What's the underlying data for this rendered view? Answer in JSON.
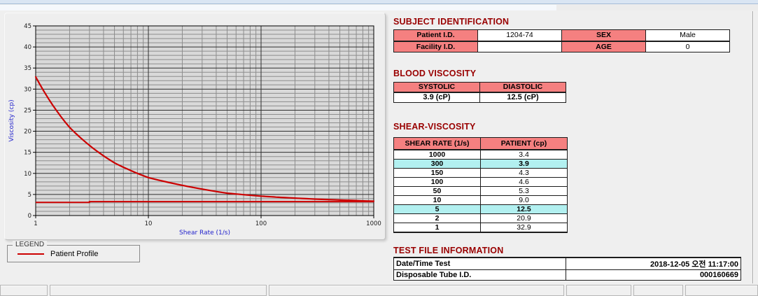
{
  "colors": {
    "accent_pink": "#f58080",
    "highlight_cyan": "#b2f0f0",
    "title_red": "#990000",
    "curve_red": "#cc0000",
    "axis_blue": "#2222cc"
  },
  "chart_data": {
    "type": "line",
    "x_scale": "log",
    "xlabel": "Shear Rate (1/s)",
    "ylabel": "Viscosity (cp)",
    "xlim": [
      1,
      1000
    ],
    "ylim": [
      0,
      45
    ],
    "x_ticks": [
      1,
      10,
      100,
      1000
    ],
    "y_ticks": [
      0,
      5,
      10,
      15,
      20,
      25,
      30,
      35,
      40,
      45
    ],
    "y_major_step": 5,
    "y_minor_step": 1,
    "grid": true,
    "legend_position": "below-left",
    "series": [
      {
        "name": "Patient Profile",
        "color": "#cc0000",
        "points": [
          [
            1,
            32.9
          ],
          [
            2,
            20.9
          ],
          [
            5,
            12.5
          ],
          [
            10,
            9.0
          ],
          [
            50,
            5.3
          ],
          [
            100,
            4.6
          ],
          [
            150,
            4.3
          ],
          [
            300,
            3.9
          ],
          [
            1000,
            3.4
          ]
        ]
      }
    ],
    "baseline": {
      "color": "#cc0000",
      "points": [
        [
          1,
          3.1
        ],
        [
          3,
          3.1
        ],
        [
          3,
          3.3
        ],
        [
          1000,
          3.3
        ]
      ]
    }
  },
  "legend": {
    "box_label": "LEGEND",
    "entries": [
      {
        "label": "Patient Profile",
        "color": "#cc0000"
      }
    ]
  },
  "subject_identification": {
    "title": "SUBJECT IDENTIFICATION",
    "rows": [
      {
        "label1": "Patient I.D.",
        "value1": "1204-74",
        "label2": "SEX",
        "value2": "Male"
      },
      {
        "label1": "Facility I.D.",
        "value1": "",
        "label2": "AGE",
        "value2": "0"
      }
    ]
  },
  "blood_viscosity": {
    "title": "BLOOD VISCOSITY",
    "headers": [
      "SYSTOLIC",
      "DIASTOLIC"
    ],
    "values": [
      "3.9 (cP)",
      "12.5 (cP)"
    ]
  },
  "shear_viscosity": {
    "title": "SHEAR-VISCOSITY",
    "headers": [
      "SHEAR RATE (1/s)",
      "PATIENT (cp)"
    ],
    "rows": [
      {
        "rate": "1000",
        "value": "3.4",
        "highlight": false
      },
      {
        "rate": "300",
        "value": "3.9",
        "highlight": true
      },
      {
        "rate": "150",
        "value": "4.3",
        "highlight": false
      },
      {
        "rate": "100",
        "value": "4.6",
        "highlight": false
      },
      {
        "rate": "50",
        "value": "5.3",
        "highlight": false
      },
      {
        "rate": "10",
        "value": "9.0",
        "highlight": false
      },
      {
        "rate": "5",
        "value": "12.5",
        "highlight": true
      },
      {
        "rate": "2",
        "value": "20.9",
        "highlight": false
      },
      {
        "rate": "1",
        "value": "32.9",
        "highlight": false
      }
    ]
  },
  "test_file_information": {
    "title": "TEST FILE INFORMATION",
    "rows": [
      {
        "label": "Date/Time Test",
        "value": "2018-12-05   오전 11:17:00"
      },
      {
        "label": "Disposable Tube I.D.",
        "value": "000160669"
      }
    ]
  }
}
